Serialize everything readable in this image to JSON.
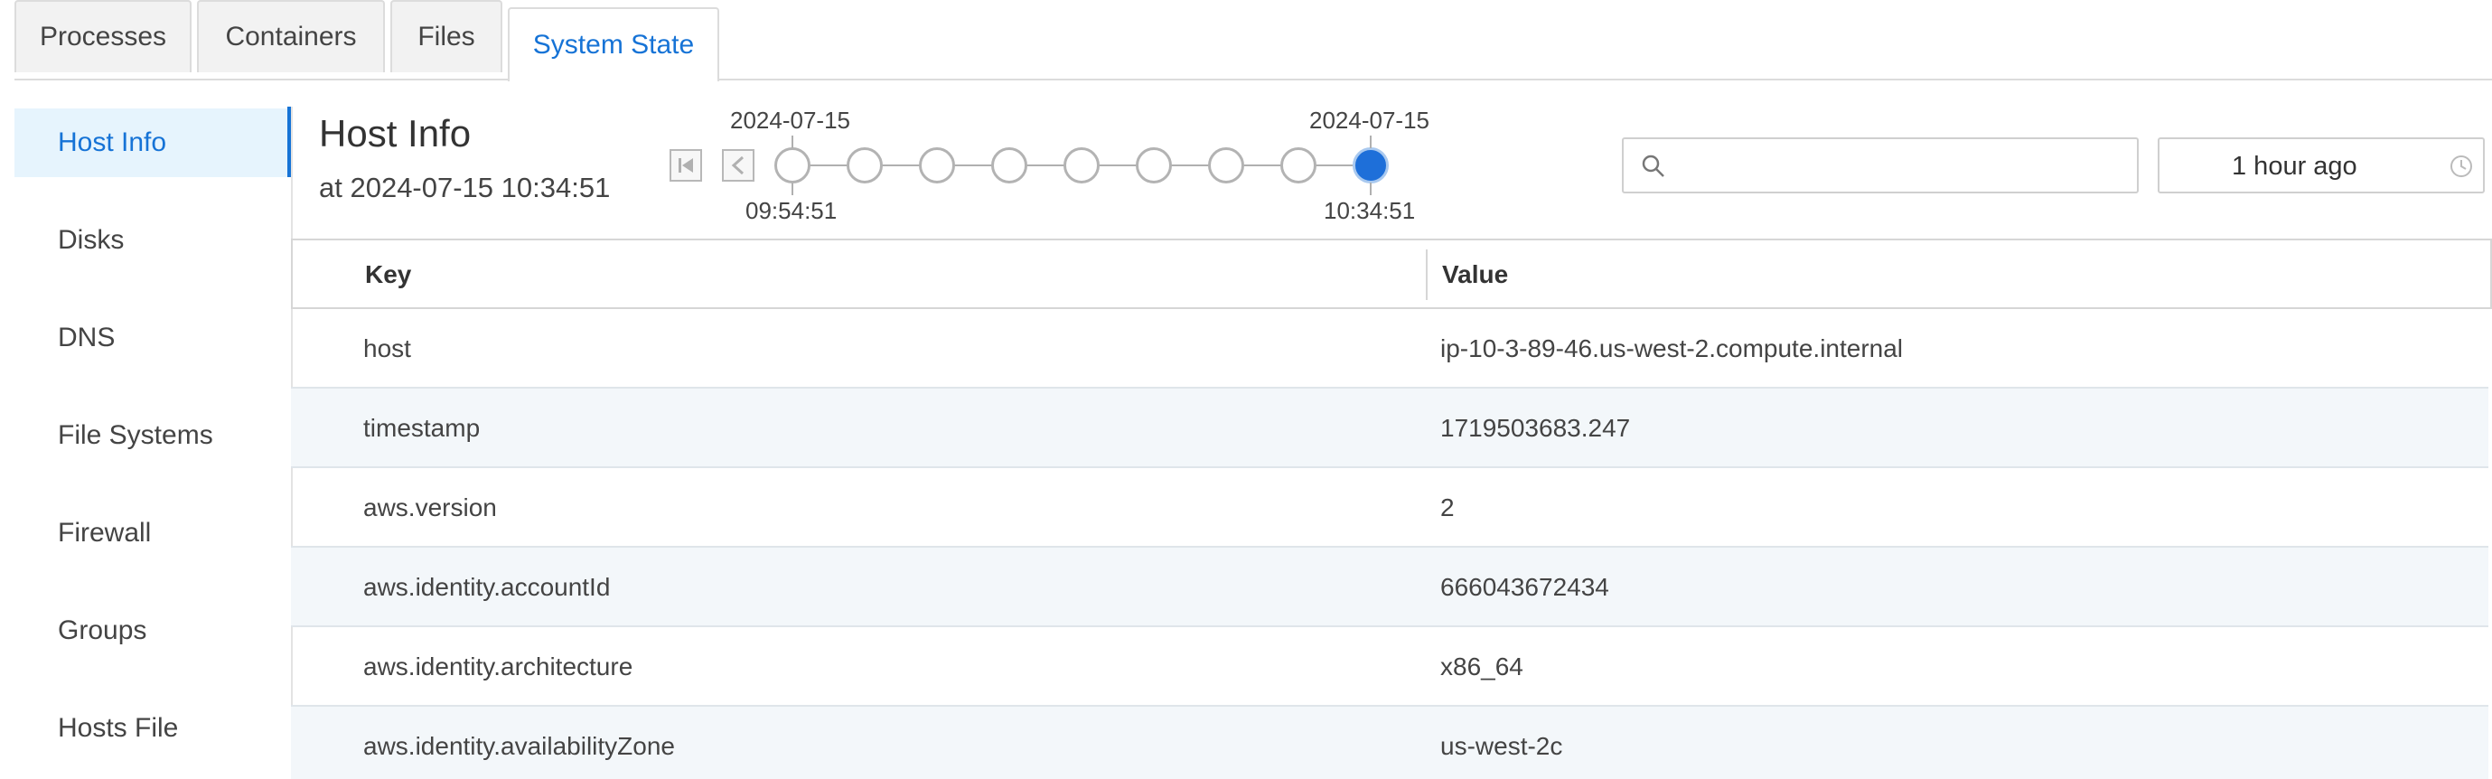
{
  "tabs": [
    {
      "label": "Processes",
      "active": false
    },
    {
      "label": "Containers",
      "active": false
    },
    {
      "label": "Files",
      "active": false
    },
    {
      "label": "System State",
      "active": true
    }
  ],
  "sidebar": {
    "items": [
      {
        "label": "Host Info",
        "active": true
      },
      {
        "label": "Disks",
        "active": false
      },
      {
        "label": "DNS",
        "active": false
      },
      {
        "label": "File Systems",
        "active": false
      },
      {
        "label": "Firewall",
        "active": false
      },
      {
        "label": "Groups",
        "active": false
      },
      {
        "label": "Hosts File",
        "active": false
      }
    ]
  },
  "header": {
    "title": "Host Info",
    "subtitle": "at 2024-07-15 10:34:51"
  },
  "timeline": {
    "start_date": "2024-07-15",
    "start_time": "09:54:51",
    "end_date": "2024-07-15",
    "end_time": "10:34:51",
    "node_count": 9,
    "active_index": 8,
    "first_icon": "skip-to-first-icon",
    "prev_icon": "chevron-left-icon"
  },
  "search": {
    "placeholder": "",
    "value": "",
    "icon": "search-icon"
  },
  "time_range": {
    "value": "1 hour ago",
    "icon": "clock-icon"
  },
  "table": {
    "columns": [
      "Key",
      "Value"
    ],
    "rows": [
      {
        "key": "host",
        "value": "ip-10-3-89-46.us-west-2.compute.internal"
      },
      {
        "key": "timestamp",
        "value": "1719503683.247"
      },
      {
        "key": "aws.version",
        "value": "2"
      },
      {
        "key": "aws.identity.accountId",
        "value": "666043672434"
      },
      {
        "key": "aws.identity.architecture",
        "value": "x86_64"
      },
      {
        "key": "aws.identity.availabilityZone",
        "value": "us-west-2c"
      }
    ]
  },
  "colors": {
    "accent": "#1673d6",
    "active_bg": "#e6f4fd",
    "alt_row": "#f3f7fa"
  }
}
